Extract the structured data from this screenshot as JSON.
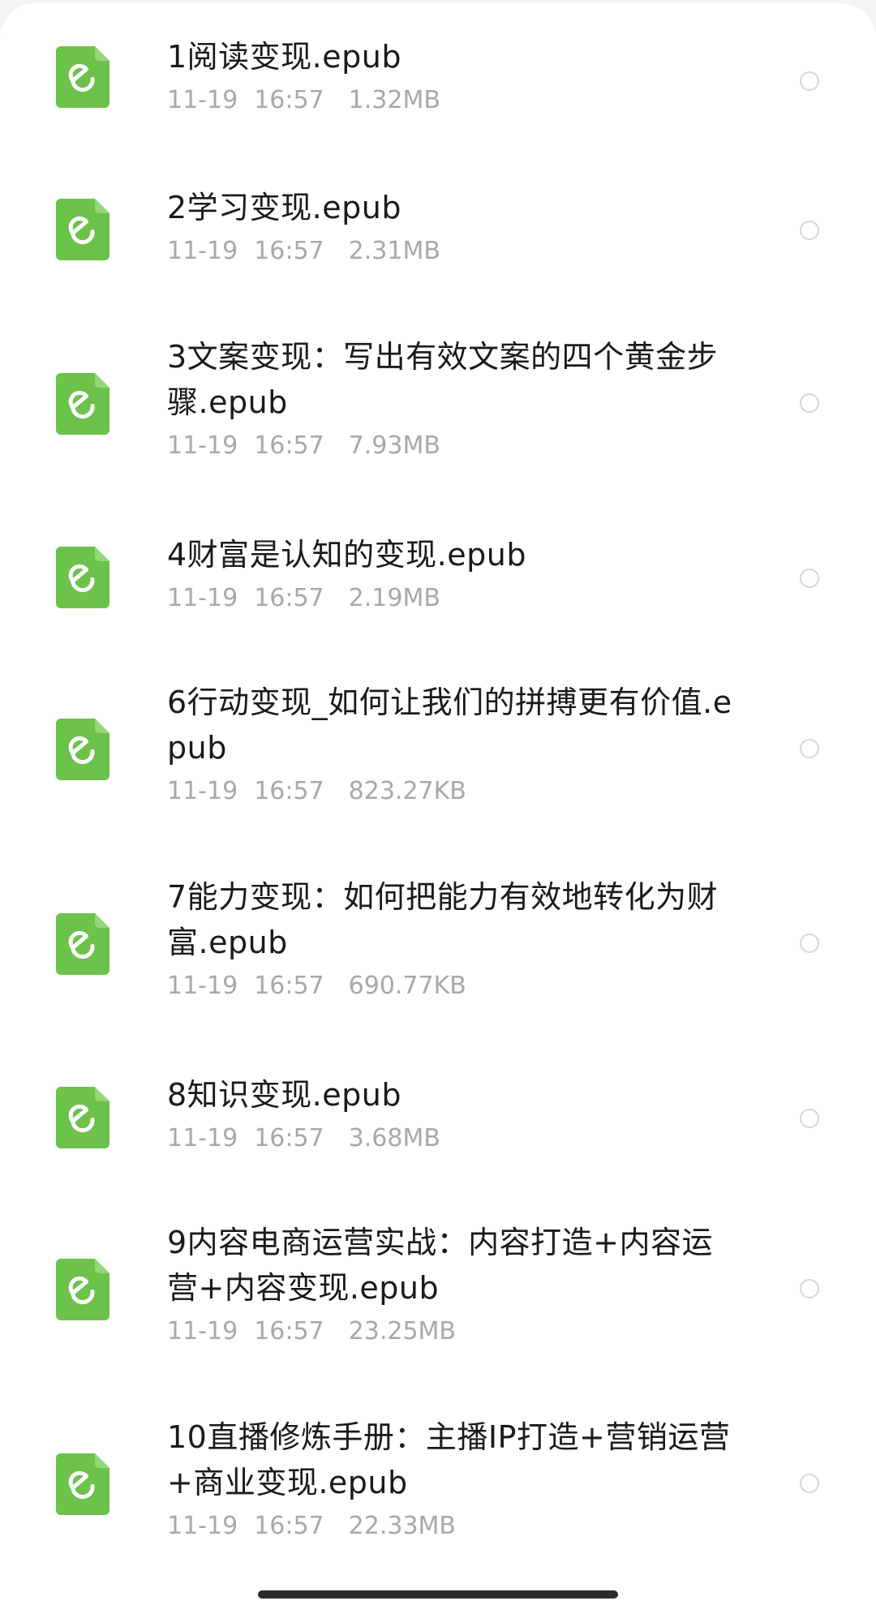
{
  "files": [
    {
      "name": "1阅读变现.epub",
      "date": "11-19",
      "time": "16:57",
      "size": "1.32MB",
      "icon": "epub-file-icon",
      "selected": false
    },
    {
      "name": "2学习变现.epub",
      "date": "11-19",
      "time": "16:57",
      "size": "2.31MB",
      "icon": "epub-file-icon",
      "selected": false
    },
    {
      "name": "3文案变现：写出有效文案的四个黄金步骤.epub",
      "date": "11-19",
      "time": "16:57",
      "size": "7.93MB",
      "icon": "epub-file-icon",
      "selected": false
    },
    {
      "name": "4财富是认知的变现.epub",
      "date": "11-19",
      "time": "16:57",
      "size": "2.19MB",
      "icon": "epub-file-icon",
      "selected": false
    },
    {
      "name": "6行动变现_如何让我们的拼搏更有价值.epub",
      "date": "11-19",
      "time": "16:57",
      "size": "823.27KB",
      "icon": "epub-file-icon",
      "selected": false
    },
    {
      "name": "7能力变现：如何把能力有效地转化为财富.epub",
      "date": "11-19",
      "time": "16:57",
      "size": "690.77KB",
      "icon": "epub-file-icon",
      "selected": false
    },
    {
      "name": "8知识变现.epub",
      "date": "11-19",
      "time": "16:57",
      "size": "3.68MB",
      "icon": "epub-file-icon",
      "selected": false
    },
    {
      "name": "9内容电商运营实战：内容打造+内容运营+内容变现.epub",
      "date": "11-19",
      "time": "16:57",
      "size": "23.25MB",
      "icon": "epub-file-icon",
      "selected": false
    },
    {
      "name": "10直播修炼手册：主播IP打造+营销运营+商业变现.epub",
      "date": "11-19",
      "time": "16:57",
      "size": "22.33MB",
      "icon": "epub-file-icon",
      "selected": false
    }
  ],
  "colors": {
    "icon_green": "#6cc24a",
    "icon_fold": "#93d877",
    "text_primary": "#1a1a1a",
    "text_secondary": "#a8a8a8",
    "radio_border": "#d7d7d7"
  }
}
